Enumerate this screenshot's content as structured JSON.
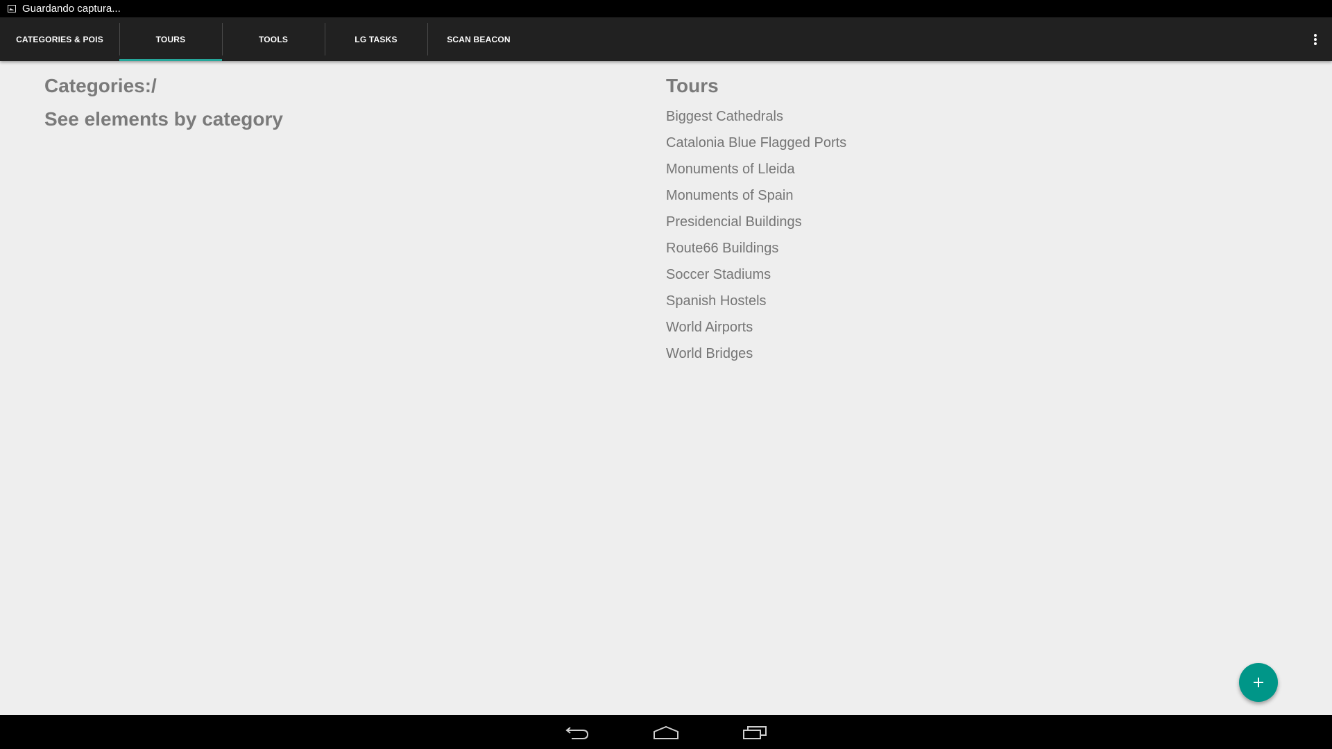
{
  "status_bar": {
    "notification_text": "Guardando captura...",
    "icon": "image-icon"
  },
  "tabs": [
    {
      "label": "CATEGORIES & POIS",
      "active": false
    },
    {
      "label": "TOURS",
      "active": true
    },
    {
      "label": "TOOLS",
      "active": false
    },
    {
      "label": "LG TASKS",
      "active": false
    },
    {
      "label": "SCAN BEACON",
      "active": false
    }
  ],
  "overflow_menu_icon": "more-vert-icon",
  "left_panel": {
    "categories_heading": "Categories:/",
    "subheading": "See elements by category"
  },
  "right_panel": {
    "title": "Tours",
    "items": [
      "Biggest Cathedrals",
      "Catalonia Blue Flagged Ports",
      "Monuments of Lleida",
      "Monuments of Spain",
      "Presidencial Buildings",
      "Route66 Buildings",
      "Soccer Stadiums",
      "Spanish Hostels",
      "World Airports",
      "World Bridges"
    ]
  },
  "fab": {
    "label": "+",
    "icon": "plus-icon"
  },
  "nav_bar": {
    "back_icon": "back-icon",
    "home_icon": "home-icon",
    "recents_icon": "recent-apps-icon"
  },
  "colors": {
    "accent": "#009688",
    "tab_indicator": "#26a69a",
    "toolbar": "#212121",
    "background": "#eeeeee",
    "text": "#757575"
  }
}
